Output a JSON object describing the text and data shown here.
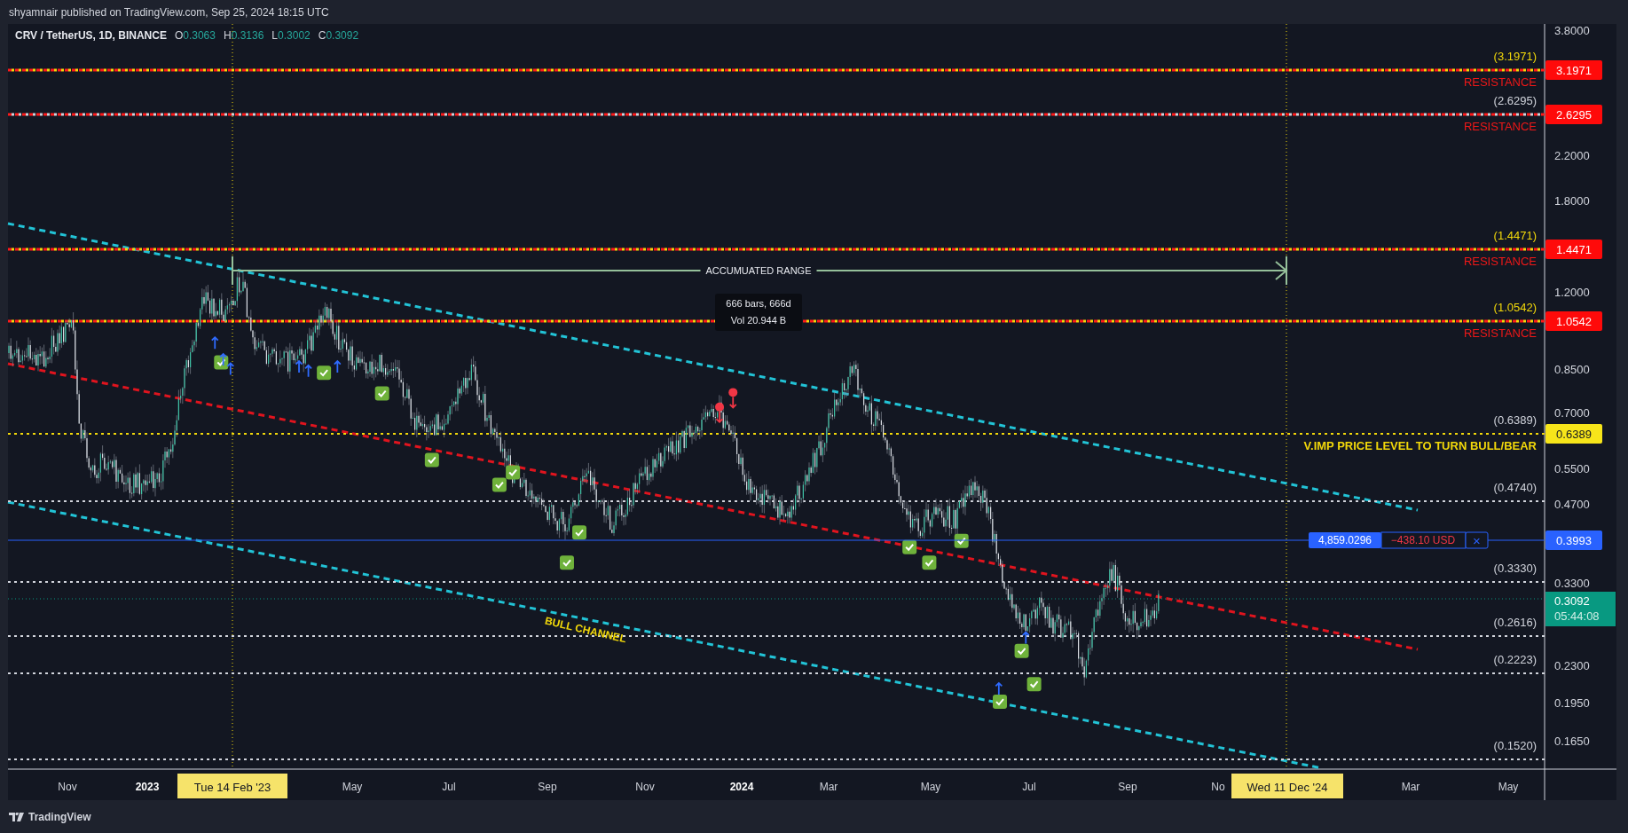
{
  "header": {
    "byline": "shyamnair published on TradingView.com, Sep 25, 2024 18:15 UTC"
  },
  "legend": {
    "symbol": "CRV / TetherUS, 1D, BINANCE",
    "ohlc": [
      {
        "label": "O",
        "value": "0.3063"
      },
      {
        "label": "H",
        "value": "0.3136"
      },
      {
        "label": "L",
        "value": "0.3002"
      },
      {
        "label": "C",
        "value": "0.3092"
      }
    ]
  },
  "levels": [
    {
      "kind": "resistance",
      "price_label": "(3.1971)",
      "color": "#f2d80a",
      "note": "RESISTANCE",
      "badge": "3.1971"
    },
    {
      "kind": "resistance",
      "price_label": "(2.6295)",
      "color": "#d1d4dc",
      "note": "RESISTANCE",
      "badge": "2.6295"
    },
    {
      "kind": "resistance",
      "price_label": "(1.4471)",
      "color": "#f2d80a",
      "note": "RESISTANCE",
      "badge": "1.4471"
    },
    {
      "kind": "resistance",
      "price_label": "(1.0542)",
      "color": "#f2d80a",
      "note": "RESISTANCE",
      "badge": "1.0542"
    },
    {
      "kind": "pivot",
      "price_label": "(0.6389)",
      "color": "#d1d4dc",
      "note": "V.IMP PRICE LEVEL TO TURN BULL/BEAR",
      "badge": "0.6389"
    },
    {
      "kind": "plain",
      "price_label": "(0.4740)",
      "color": "#d1d4dc"
    },
    {
      "kind": "plain",
      "price_label": "(0.3330)",
      "color": "#d1d4dc"
    },
    {
      "kind": "plain",
      "price_label": "(0.2616)",
      "color": "#d1d4dc"
    },
    {
      "kind": "plain",
      "price_label": "(0.2223)",
      "color": "#d1d4dc"
    },
    {
      "kind": "plain",
      "price_label": "(0.1520)",
      "color": "#d1d4dc"
    }
  ],
  "position": {
    "quantity": "4,859.0296",
    "pnl": "−438.10 USD",
    "close": "×",
    "badge": "0.3993"
  },
  "last_price": {
    "value": "0.3092",
    "countdown": "05:44:08"
  },
  "price_axis": {
    "labels": [
      "3.8000",
      "2.2000",
      "1.8000",
      "1.2000",
      "0.8500",
      "0.7000",
      "0.5500",
      "0.4700",
      "0.3300",
      "0.2300",
      "0.1950",
      "0.1650"
    ]
  },
  "time_axis": {
    "labels": [
      {
        "text": "Nov",
        "kind": "month"
      },
      {
        "text": "2023",
        "kind": "year"
      },
      {
        "text": "May",
        "kind": "month"
      },
      {
        "text": "Jul",
        "kind": "month"
      },
      {
        "text": "Sep",
        "kind": "month"
      },
      {
        "text": "Nov",
        "kind": "month"
      },
      {
        "text": "2024",
        "kind": "year"
      },
      {
        "text": "Mar",
        "kind": "month"
      },
      {
        "text": "May",
        "kind": "month"
      },
      {
        "text": "Jul",
        "kind": "month"
      },
      {
        "text": "Sep",
        "kind": "month"
      },
      {
        "text": "No",
        "kind": "month"
      },
      {
        "text": "Mar",
        "kind": "month"
      },
      {
        "text": "May",
        "kind": "month"
      }
    ],
    "date_badges": [
      "Tue 14 Feb '23",
      "Wed 11 Dec '24"
    ]
  },
  "annotations": {
    "range_label": "ACCUMUATED RANGE",
    "range_stats": [
      "666 bars, 666d",
      "Vol 20.944 B"
    ],
    "channel_label": "BULL CHANNEL"
  },
  "footer": {
    "brand": "TradingView"
  }
}
